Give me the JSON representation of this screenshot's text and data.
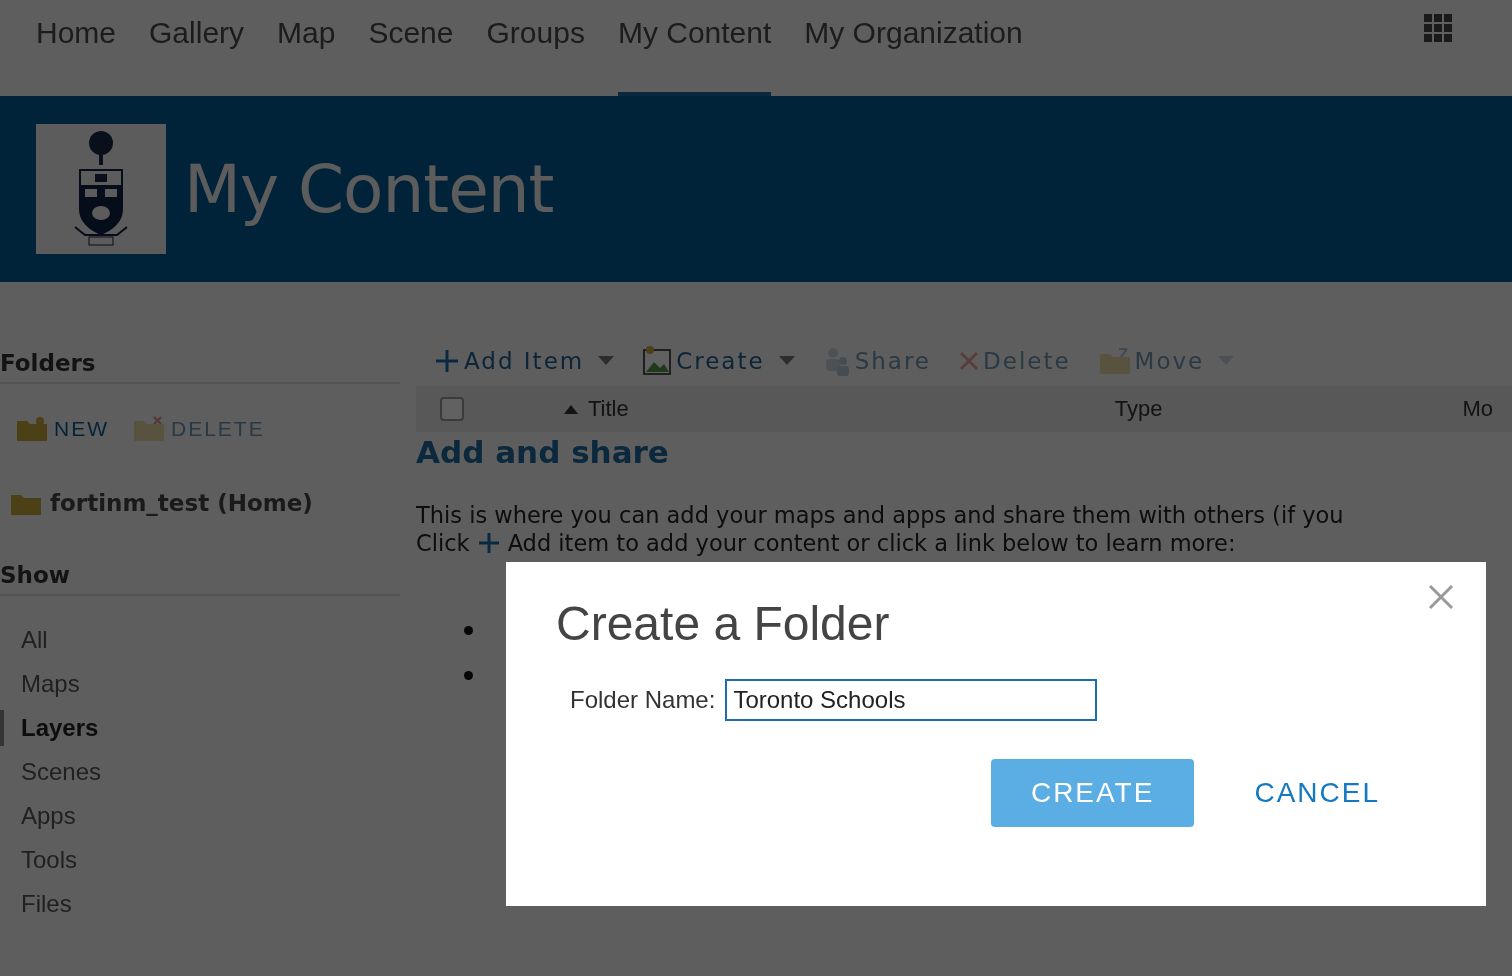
{
  "nav": {
    "tabs": [
      {
        "label": "Home",
        "selected": false
      },
      {
        "label": "Gallery",
        "selected": false
      },
      {
        "label": "Map",
        "selected": false
      },
      {
        "label": "Scene",
        "selected": false
      },
      {
        "label": "Groups",
        "selected": false
      },
      {
        "label": "My Content",
        "selected": true
      },
      {
        "label": "My Organization",
        "selected": false
      }
    ]
  },
  "banner": {
    "title": "My Content"
  },
  "sidebar": {
    "folders": {
      "heading": "Folders",
      "actions": [
        {
          "label": "NEW",
          "kind": "new",
          "disabled": false
        },
        {
          "label": "DELETE",
          "kind": "delete",
          "disabled": true
        }
      ],
      "items": [
        {
          "label": "fortinm_test (Home)"
        }
      ]
    },
    "show": {
      "heading": "Show",
      "items": [
        {
          "label": "All",
          "selected": false
        },
        {
          "label": "Maps",
          "selected": false
        },
        {
          "label": "Layers",
          "selected": true
        },
        {
          "label": "Scenes",
          "selected": false
        },
        {
          "label": "Apps",
          "selected": false
        },
        {
          "label": "Tools",
          "selected": false
        },
        {
          "label": "Files",
          "selected": false
        }
      ]
    }
  },
  "toolbar": [
    {
      "label": "Add Item",
      "kind": "add",
      "disabled": false,
      "dropdown": true
    },
    {
      "label": "Create",
      "kind": "create",
      "disabled": false,
      "dropdown": true
    },
    {
      "label": "Share",
      "kind": "share",
      "disabled": true,
      "dropdown": false
    },
    {
      "label": "Delete",
      "kind": "delete",
      "disabled": true,
      "dropdown": false
    },
    {
      "label": "Move",
      "kind": "move",
      "disabled": true,
      "dropdown": true
    }
  ],
  "table": {
    "select_all": {
      "checked": false
    },
    "columns": [
      {
        "label": "Title",
        "sorted": true
      },
      {
        "label": "Type",
        "sorted": false
      },
      {
        "label": "Mo",
        "sorted": false
      }
    ]
  },
  "empty_state": {
    "heading": "Add and share",
    "text": "This is where you can add your maps and apps and share them with others (if you",
    "click_word": "Click",
    "click_rest": "Add item to add your content or click a link below to learn more:",
    "links": [
      {
        "kind": "bullet"
      },
      {
        "kind": "bullet"
      }
    ]
  },
  "modal": {
    "title": "Create a Folder",
    "field": {
      "label": "Folder Name:",
      "value": "Toronto Schools"
    },
    "buttons": [
      {
        "label": "CREATE",
        "kind": "primary"
      },
      {
        "label": "CANCEL",
        "kind": "link"
      }
    ]
  }
}
